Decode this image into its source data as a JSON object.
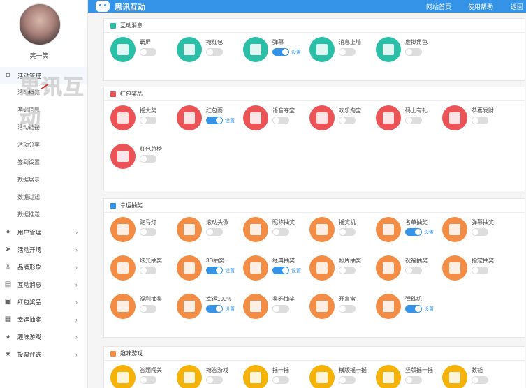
{
  "user": {
    "name": "笑一笑"
  },
  "watermark": "思讯互动",
  "top": {
    "brand": "思讯互动",
    "nav": [
      "网站首页",
      "使用帮助",
      "返回"
    ]
  },
  "sidebar": {
    "current_group": "活动管理",
    "sub_items": [
      "活动概览",
      "基础信息",
      "活动链接",
      "活动分享",
      "签到设置",
      "数据展示",
      "数据过滤",
      "数据推送"
    ],
    "groups": [
      {
        "label": "用户管理",
        "icon": "user-icon"
      },
      {
        "label": "活动开场",
        "icon": "send-icon"
      },
      {
        "label": "品牌形象",
        "icon": "brand-icon"
      },
      {
        "label": "互动消息",
        "icon": "message-icon"
      },
      {
        "label": "红包奖品",
        "icon": "wallet-icon"
      },
      {
        "label": "幸运抽奖",
        "icon": "grid-icon"
      },
      {
        "label": "趣味游戏",
        "icon": "game-icon"
      },
      {
        "label": "投票评选",
        "icon": "star-icon"
      }
    ]
  },
  "settings_label": "设置",
  "sections": [
    {
      "title": "互动消息",
      "items": [
        {
          "label": "霸屏",
          "on": false,
          "color": "teal"
        },
        {
          "label": "抢红包",
          "on": false,
          "color": "teal"
        },
        {
          "label": "弹幕",
          "on": true,
          "color": "teal"
        },
        {
          "label": "消息上墙",
          "on": false,
          "color": "teal"
        },
        {
          "label": "虚拟角色",
          "on": false,
          "color": "teal"
        }
      ]
    },
    {
      "title": "红包奖品",
      "items": [
        {
          "label": "摇大奖",
          "on": false,
          "color": "red"
        },
        {
          "label": "红包雨",
          "on": true,
          "color": "red"
        },
        {
          "label": "语音夺宝",
          "on": false,
          "color": "red"
        },
        {
          "label": "欢乐淘宝",
          "on": false,
          "color": "red"
        },
        {
          "label": "码上有礼",
          "on": false,
          "color": "red"
        },
        {
          "label": "恭喜发财",
          "on": false,
          "color": "red"
        },
        {
          "label": "红包总榜",
          "on": false,
          "color": "red"
        }
      ]
    },
    {
      "title": "幸运抽奖",
      "items": [
        {
          "label": "跑马灯",
          "on": false,
          "color": "orange"
        },
        {
          "label": "滚动头像",
          "on": false,
          "color": "orange"
        },
        {
          "label": "昵称抽奖",
          "on": false,
          "color": "orange"
        },
        {
          "label": "摇奖机",
          "on": false,
          "color": "orange"
        },
        {
          "label": "名单抽奖",
          "on": true,
          "color": "orange"
        },
        {
          "label": "弹幕抽奖",
          "on": false,
          "color": "orange"
        },
        {
          "label": "炫光抽奖",
          "on": false,
          "color": "orange"
        },
        {
          "label": "3D抽奖",
          "on": true,
          "color": "orange"
        },
        {
          "label": "经典抽奖",
          "on": true,
          "color": "orange"
        },
        {
          "label": "照片抽奖",
          "on": false,
          "color": "orange"
        },
        {
          "label": "祝福抽奖",
          "on": false,
          "color": "orange"
        },
        {
          "label": "指定抽奖",
          "on": false,
          "color": "orange"
        },
        {
          "label": "福利抽奖",
          "on": false,
          "color": "orange"
        },
        {
          "label": "幸运100%",
          "on": true,
          "color": "orange"
        },
        {
          "label": "奖券抽奖",
          "on": false,
          "color": "orange"
        },
        {
          "label": "开盲盒",
          "on": false,
          "color": "orange"
        },
        {
          "label": "弹珠机",
          "on": true,
          "color": "orange"
        }
      ]
    },
    {
      "title": "趣味游戏",
      "items": [
        {
          "label": "答题闯关",
          "on": false,
          "color": "yellow"
        },
        {
          "label": "抢答游戏",
          "on": false,
          "color": "yellow"
        },
        {
          "label": "摇一摇",
          "on": false,
          "color": "yellow"
        },
        {
          "label": "横版摇一摇",
          "on": false,
          "color": "yellow"
        },
        {
          "label": "竖版摇一摇",
          "on": false,
          "color": "yellow"
        },
        {
          "label": "数钱",
          "on": false,
          "color": "yellow"
        }
      ]
    }
  ]
}
